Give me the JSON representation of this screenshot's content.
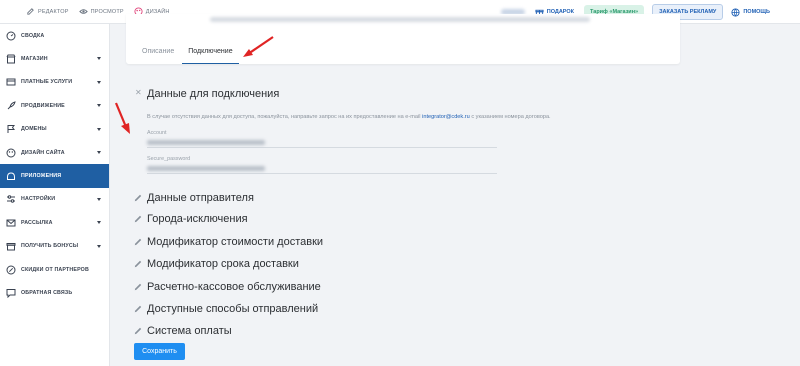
{
  "toolbar": {
    "editor_label": "Редактор",
    "preview_label": "Просмотр",
    "design_label": "Дизайн",
    "gift_label": "Подарок",
    "tariff_label": "Тариф «Магазин»",
    "order_ads_label": "Заказать рекламу",
    "help_label": "Помощь"
  },
  "sidebar": {
    "items": [
      {
        "label": "Сводка",
        "icon": "dashboard-icon",
        "has_chevron": false
      },
      {
        "label": "Магазин",
        "icon": "store-icon",
        "has_chevron": true
      },
      {
        "label": "Платные услуги",
        "icon": "paid-services-icon",
        "has_chevron": true
      },
      {
        "label": "Продвижение",
        "icon": "rocket-icon",
        "has_chevron": true
      },
      {
        "label": "Домены",
        "icon": "flag-icon",
        "has_chevron": true
      },
      {
        "label": "Дизайн сайта",
        "icon": "palette-icon",
        "has_chevron": true
      },
      {
        "label": "Приложения",
        "icon": "apps-icon",
        "has_chevron": false,
        "active": true
      },
      {
        "label": "Настройки",
        "icon": "settings-sliders-icon",
        "has_chevron": true
      },
      {
        "label": "Рассылка",
        "icon": "mail-icon",
        "has_chevron": true
      },
      {
        "label": "Получить бонусы",
        "icon": "gift-box-icon",
        "has_chevron": true
      },
      {
        "label": "Скидки от партнеров",
        "icon": "discount-icon",
        "has_chevron": false
      },
      {
        "label": "Обратная связь",
        "icon": "chat-icon",
        "has_chevron": false
      }
    ]
  },
  "tabs": [
    {
      "label": "Описание",
      "active": false
    },
    {
      "label": "Подключение",
      "active": true
    }
  ],
  "connection": {
    "title": "Данные для подключения",
    "note_prefix": "В случае отсутствия данных для доступа, пожалуйста, направьте запрос на их предоставление на e-mail",
    "note_email": "integrator@cdek.ru",
    "note_suffix": "с указанием номера договора.",
    "fields": [
      {
        "label": "Account"
      },
      {
        "label": "Secure_password"
      }
    ]
  },
  "sections": [
    "Данные отправителя",
    "Города-исключения",
    "Модификатор стоимости доставки",
    "Модификатор срока доставки",
    "Расчетно-кассовое обслуживание",
    "Доступные способы отправлений",
    "Система оплаты"
  ],
  "save_button_label": "Сохранить",
  "colors": {
    "sidebar_active": "#1f5fa3",
    "primary_button": "#1f8ef1",
    "annotation_arrow": "#e02424"
  }
}
